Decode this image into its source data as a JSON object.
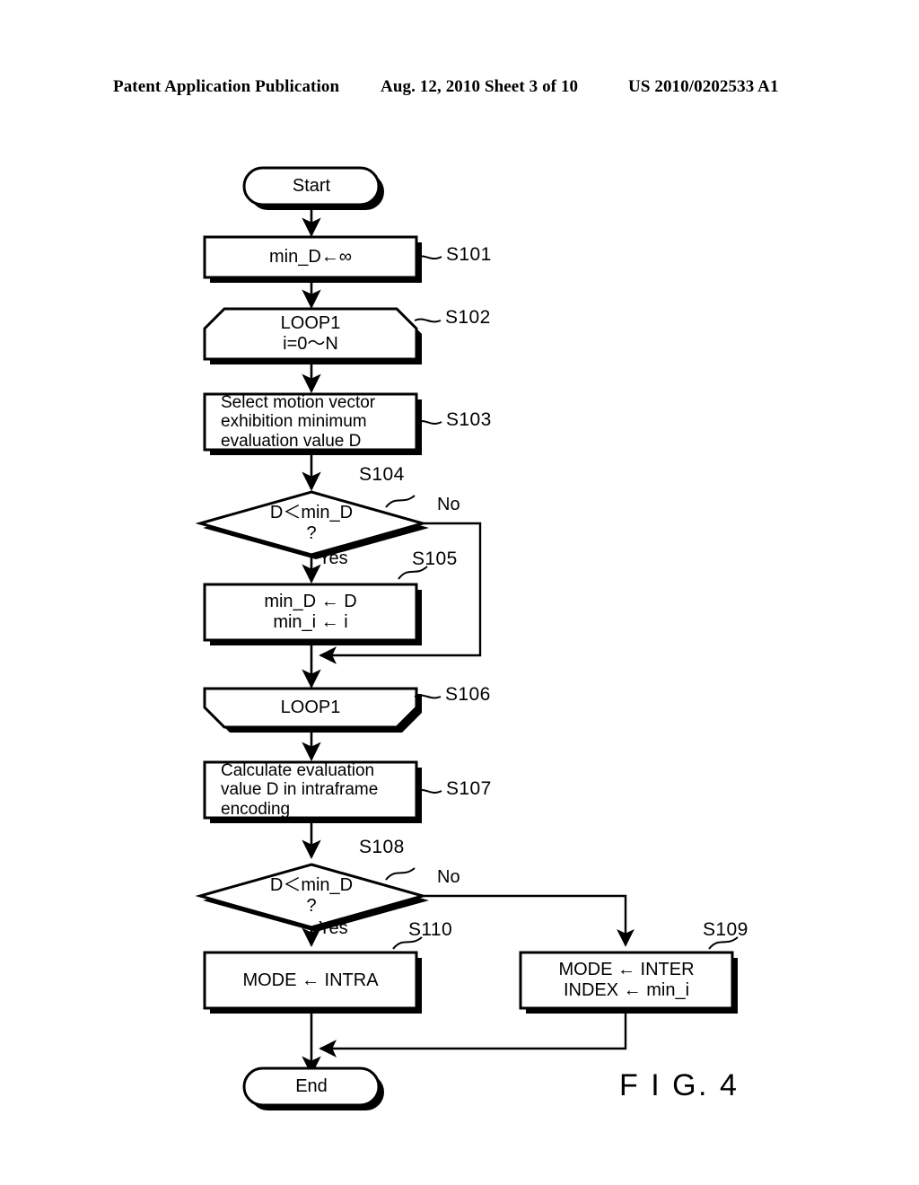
{
  "header": {
    "left": "Patent Application Publication",
    "middle": "Aug. 12, 2010  Sheet 3 of 10",
    "right": "US 2010/0202533 A1"
  },
  "figure": {
    "label": "F I G. 4",
    "colors": {
      "stroke": "#000000",
      "fill": "#ffffff",
      "shadow": "#000000"
    }
  },
  "flowchart": {
    "type": "flowchart",
    "nodes": [
      {
        "id": "start",
        "shape": "terminal",
        "text": "Start",
        "step": ""
      },
      {
        "id": "s101",
        "shape": "process",
        "text": "min_D←∞",
        "step": "S101"
      },
      {
        "id": "s102",
        "shape": "loop-start",
        "text_line1": "LOOP1",
        "text_line2": "i=0～N",
        "step": "S102"
      },
      {
        "id": "s103",
        "shape": "process",
        "text_line1": "Select motion vector",
        "text_line2": "exhibition minimum",
        "text_line3": "evaluation value D",
        "step": "S103"
      },
      {
        "id": "s104",
        "shape": "decision",
        "text_line1": "D＜min_D",
        "text_line2": "?",
        "step": "S104",
        "branch_yes": "Yes",
        "branch_no": "No"
      },
      {
        "id": "s105",
        "shape": "process",
        "text_line1": "min_D ← D",
        "text_line2": "min_i ← i",
        "step": "S105"
      },
      {
        "id": "s106",
        "shape": "loop-end",
        "text": "LOOP1",
        "step": "S106"
      },
      {
        "id": "s107",
        "shape": "process",
        "text_line1": "Calculate evaluation",
        "text_line2": "value D in intraframe",
        "text_line3": "encoding",
        "step": "S107"
      },
      {
        "id": "s108",
        "shape": "decision",
        "text_line1": "D＜min_D",
        "text_line2": "?",
        "step": "S108",
        "branch_yes": "Yes",
        "branch_no": "No"
      },
      {
        "id": "s109",
        "shape": "process",
        "text_line1": "MODE ← INTER",
        "text_line2": "INDEX ← min_i",
        "step": "S109"
      },
      {
        "id": "s110",
        "shape": "process",
        "text": "MODE ← INTRA",
        "step": "S110"
      },
      {
        "id": "end",
        "shape": "terminal",
        "text": "End",
        "step": ""
      }
    ]
  }
}
